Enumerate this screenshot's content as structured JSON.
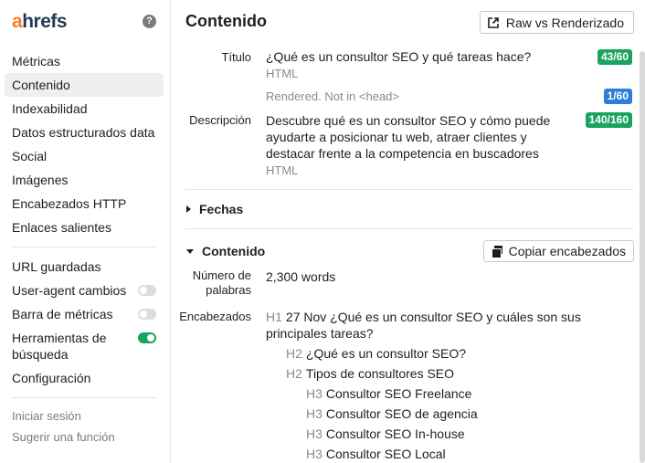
{
  "brand": {
    "logo_a": "a",
    "logo_rest": "hrefs",
    "help_glyph": "?"
  },
  "sidebar": {
    "items": [
      {
        "label": "Métricas"
      },
      {
        "label": "Contenido",
        "active": true
      },
      {
        "label": "Indexabilidad"
      },
      {
        "label": "Datos estructurados data"
      },
      {
        "label": "Social"
      },
      {
        "label": "Imágenes"
      },
      {
        "label": "Encabezados HTTP"
      },
      {
        "label": "Enlaces salientes"
      }
    ],
    "tools": [
      {
        "label": "URL guardadas"
      },
      {
        "label": "User-agent cambios",
        "toggle": "off"
      },
      {
        "label": "Barra de métricas",
        "toggle": "off"
      },
      {
        "label": "Herramientas de búsqueda",
        "toggle": "on"
      },
      {
        "label": "Configuración"
      }
    ],
    "footer": [
      {
        "label": "Iniciar sesión"
      },
      {
        "label": "Sugerir una función"
      }
    ]
  },
  "header": {
    "title": "Contenido",
    "raw_button": "Raw vs Renderizado"
  },
  "meta": {
    "title_label": "Título",
    "title_value": "¿Qué es un consultor SEO y qué tareas hace?",
    "title_source": "HTML",
    "title_badge": "43/60",
    "rendered_text": "Rendered. Not in <head>",
    "rendered_badge": "1/60",
    "desc_label": "Descripción",
    "desc_value": "Descubre qué es un consultor SEO y cómo puede ayudarte a posicionar tu web, atraer clientes y destacar frente a la competencia en buscadores",
    "desc_source": "HTML",
    "desc_badge": "140/160"
  },
  "sections": {
    "dates": "Fechas",
    "content": "Contenido",
    "copy_button": "Copiar encabezados"
  },
  "content": {
    "words_label": "Número de palabras",
    "words_value": "2,300 words",
    "headings_label": "Encabezados",
    "headings": [
      {
        "tag": "H1",
        "text": "27 Nov ¿Qué es un consultor SEO y cuáles son sus principales tareas?"
      },
      {
        "tag": "H2",
        "text": "¿Qué es un consultor SEO?"
      },
      {
        "tag": "H2",
        "text": "Tipos de consultores SEO"
      },
      {
        "tag": "H3",
        "text": "Consultor SEO Freelance"
      },
      {
        "tag": "H3",
        "text": "Consultor SEO de agencia"
      },
      {
        "tag": "H3",
        "text": "Consultor SEO In-house"
      },
      {
        "tag": "H3",
        "text": "Consultor SEO Local"
      }
    ]
  }
}
